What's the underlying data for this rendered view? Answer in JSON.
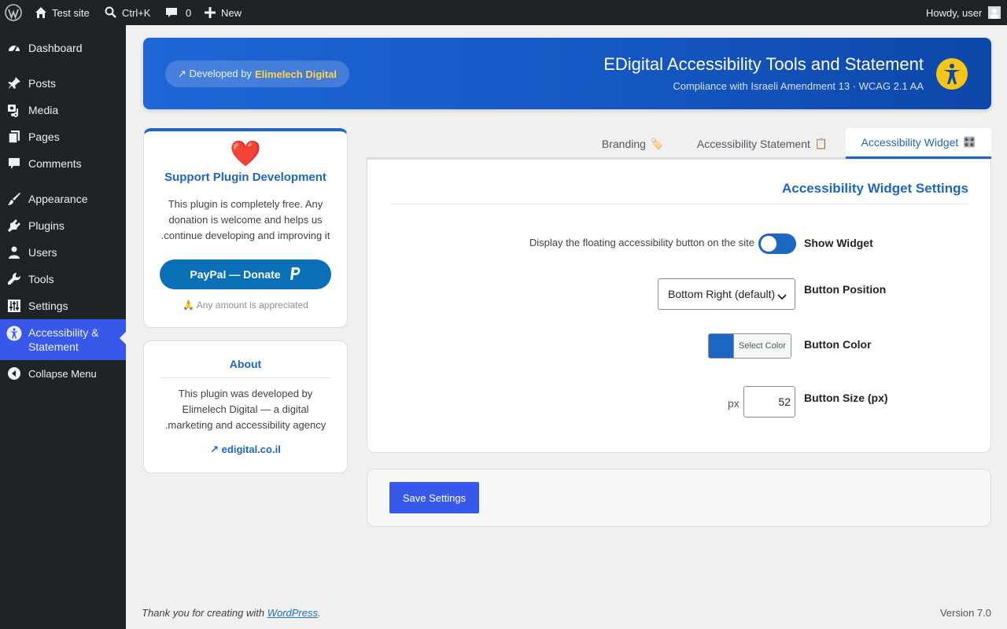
{
  "admin_bar": {
    "site_name": "Test site",
    "search_shortcut": "Ctrl+K",
    "comments_count": "0",
    "new_label": "New",
    "greeting": "Howdy, user"
  },
  "sidebar": {
    "items": [
      {
        "label": "Dashboard",
        "icon": "dashboard-icon"
      },
      {
        "label": "Posts",
        "icon": "pin-icon"
      },
      {
        "label": "Media",
        "icon": "media-icon"
      },
      {
        "label": "Pages",
        "icon": "pages-icon"
      },
      {
        "label": "Comments",
        "icon": "comment-icon"
      },
      {
        "label": "Appearance",
        "icon": "brush-icon"
      },
      {
        "label": "Plugins",
        "icon": "plug-icon"
      },
      {
        "label": "Users",
        "icon": "user-icon"
      },
      {
        "label": "Tools",
        "icon": "wrench-icon"
      },
      {
        "label": "Settings",
        "icon": "sliders-icon"
      },
      {
        "label": "Accessibility &",
        "label2": "Statement",
        "icon": "accessibility-icon"
      },
      {
        "label": "Collapse Menu",
        "icon": "collapse-icon"
      }
    ]
  },
  "banner": {
    "dev_prefix": "↗ Developed by",
    "dev_name": "Elimelech Digital",
    "title": "EDigital Accessibility Tools and Statement",
    "subtitle": "Compliance with Israeli Amendment 13 · WCAG 2.1 AA"
  },
  "support": {
    "heart": "❤️",
    "title": "Support Plugin Development",
    "line1": "This plugin is completely free. Any",
    "line2": "donation is welcome and helps us",
    "line3": ".continue developing and improving it",
    "donate_label": "PayPal — Donate",
    "note": "🙏 Any amount is appreciated"
  },
  "about": {
    "title": "About",
    "line1": "This plugin was developed by",
    "line2": "Elimelech Digital — a digital",
    "line3": ".marketing and accessibility agency",
    "link": "↗ edigital.co.il"
  },
  "tabs": [
    {
      "label": "Branding",
      "emoji": "🏷️"
    },
    {
      "label": "Accessibility Statement",
      "emoji": "📋"
    },
    {
      "label": "Accessibility Widget",
      "emoji": "🎛️"
    }
  ],
  "settings": {
    "title": "Accessibility Widget Settings",
    "show_widget": {
      "label": "Show Widget",
      "description": "Display the floating accessibility button on the site",
      "enabled": true
    },
    "position": {
      "label": "Button Position",
      "value": "Bottom Right (default)"
    },
    "color": {
      "label": "Button Color",
      "button": "Select Color",
      "value": "#1c66c4"
    },
    "size": {
      "label": "Button Size (px)",
      "unit": "px",
      "value": "52"
    }
  },
  "save": {
    "label": "Save Settings"
  },
  "footer": {
    "thanks_prefix": "Thank you for creating with",
    "thanks_link": "WordPress",
    "thanks_suffix": ".",
    "version": "Version 7.0"
  },
  "colors": {
    "accent": "#1c66c4",
    "admin_dark": "#1d2327",
    "active_menu": "#3858e9",
    "banner_icon": "#f5c518"
  }
}
